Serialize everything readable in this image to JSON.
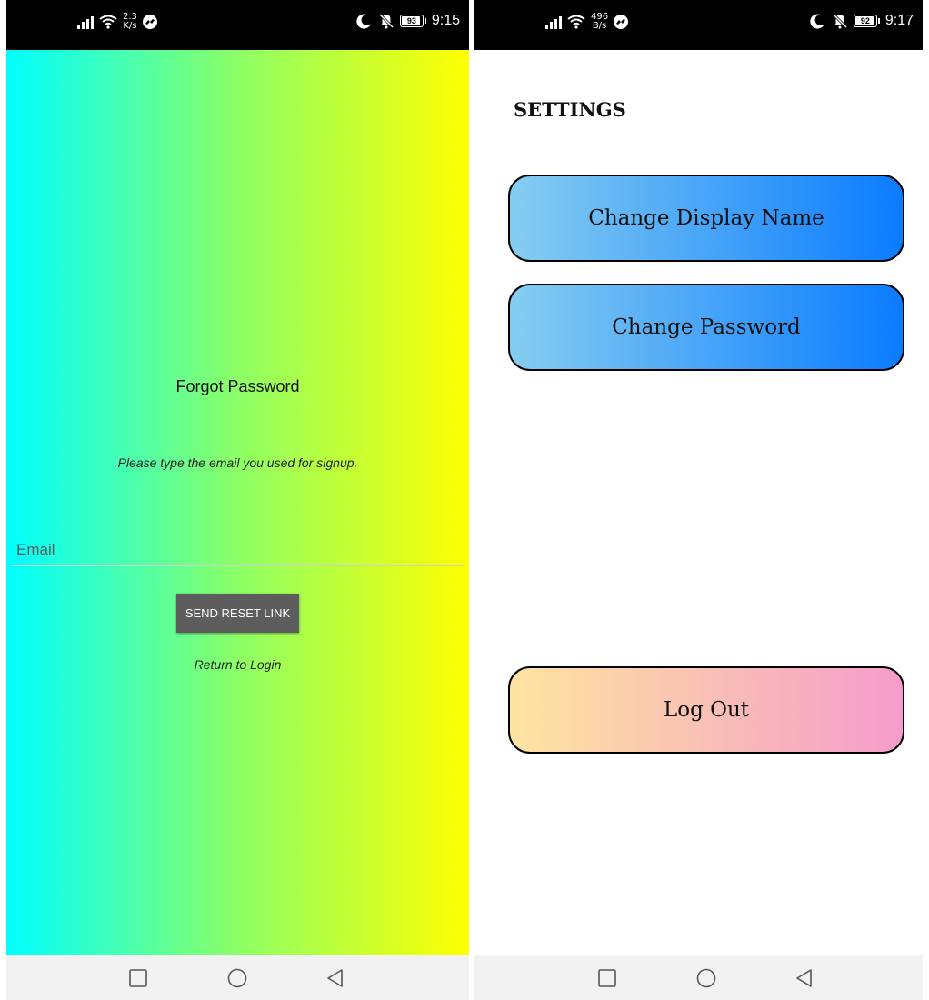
{
  "colors": {
    "left_gradient": [
      "#00ffff",
      "#8cff66",
      "#ffff00"
    ],
    "blue_button_gradient": [
      "#86cdf0",
      "#0a7cff"
    ],
    "warm_button_gradient": [
      "#fde4a0",
      "#f59ccb"
    ],
    "send_button_bg": "#5d5d5d"
  },
  "left_screen": {
    "status_bar": {
      "speed_value": "2.3",
      "speed_unit": "K/s",
      "battery": "93",
      "time": "9:15",
      "icons": [
        "signal-icon",
        "wifi-icon",
        "messenger-icon",
        "moon-icon",
        "mute-bell-icon",
        "battery-icon"
      ]
    },
    "title": "Forgot Password",
    "description": "Please type the email you used for signup.",
    "email_placeholder": "Email",
    "send_button_label": "SEND RESET LINK",
    "return_link_label": "Return to Login"
  },
  "right_screen": {
    "status_bar": {
      "speed_value": "496",
      "speed_unit": "B/s",
      "battery": "92",
      "time": "9:17"
    },
    "title": "SETTINGS",
    "buttons": [
      {
        "label": "Change Display Name"
      },
      {
        "label": "Change Password"
      },
      {
        "label": "Log Out"
      }
    ]
  },
  "nav_bar": {
    "icons": [
      "recent-apps-square-icon",
      "home-circle-icon",
      "back-triangle-icon"
    ]
  }
}
